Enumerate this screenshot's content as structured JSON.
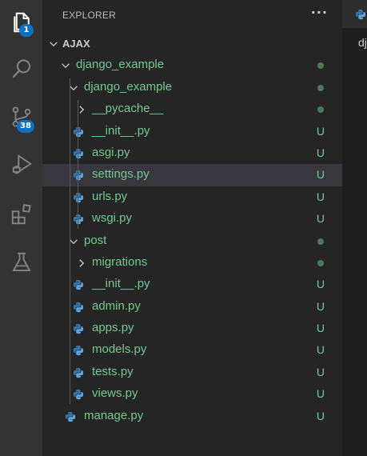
{
  "colors": {
    "activity_bg": "#333333",
    "sidebar_bg": "#252526",
    "icon_active": "#ffffff",
    "icon_inactive": "#858585",
    "badge_bg": "#0e70c0",
    "untracked": "#73c991",
    "dot": "#4d7a5a",
    "python_blue": "#3572a5",
    "python_light": "#5da5e0"
  },
  "activity_bar": {
    "explorer_badge": "1",
    "source_control_badge": "38",
    "icons": [
      "files-icon",
      "search-icon",
      "source-control-icon",
      "run-debug-icon",
      "extensions-icon",
      "testing-icon"
    ]
  },
  "sidebar": {
    "title": "EXPLORER",
    "more_actions": "···"
  },
  "tree": {
    "root": "AJAX",
    "items": [
      {
        "label": "django_example",
        "type": "folder",
        "depth": 1,
        "status": "dot"
      },
      {
        "label": "django_example",
        "type": "folder",
        "depth": 2,
        "status": "dot"
      },
      {
        "label": "__pycache__",
        "type": "folder-collapsed",
        "depth": 3,
        "status": "dot"
      },
      {
        "label": "__init__.py",
        "type": "py",
        "depth": 3,
        "status": "U"
      },
      {
        "label": "asgi.py",
        "type": "py",
        "depth": 3,
        "status": "U"
      },
      {
        "label": "settings.py",
        "type": "py",
        "depth": 3,
        "status": "U",
        "selected": true
      },
      {
        "label": "urls.py",
        "type": "py",
        "depth": 3,
        "status": "U"
      },
      {
        "label": "wsgi.py",
        "type": "py",
        "depth": 3,
        "status": "U"
      },
      {
        "label": "post",
        "type": "folder",
        "depth": 2,
        "status": "dot"
      },
      {
        "label": "migrations",
        "type": "folder-collapsed",
        "depth": 3,
        "status": "dot"
      },
      {
        "label": "__init__.py",
        "type": "py",
        "depth": 3,
        "status": "U"
      },
      {
        "label": "admin.py",
        "type": "py",
        "depth": 3,
        "status": "U"
      },
      {
        "label": "apps.py",
        "type": "py",
        "depth": 3,
        "status": "U"
      },
      {
        "label": "models.py",
        "type": "py",
        "depth": 3,
        "status": "U"
      },
      {
        "label": "tests.py",
        "type": "py",
        "depth": 3,
        "status": "U"
      },
      {
        "label": "views.py",
        "type": "py",
        "depth": 3,
        "status": "U"
      },
      {
        "label": "manage.py",
        "type": "py",
        "depth": 2,
        "status": "U"
      }
    ]
  },
  "editor": {
    "tab_label": "dj"
  }
}
